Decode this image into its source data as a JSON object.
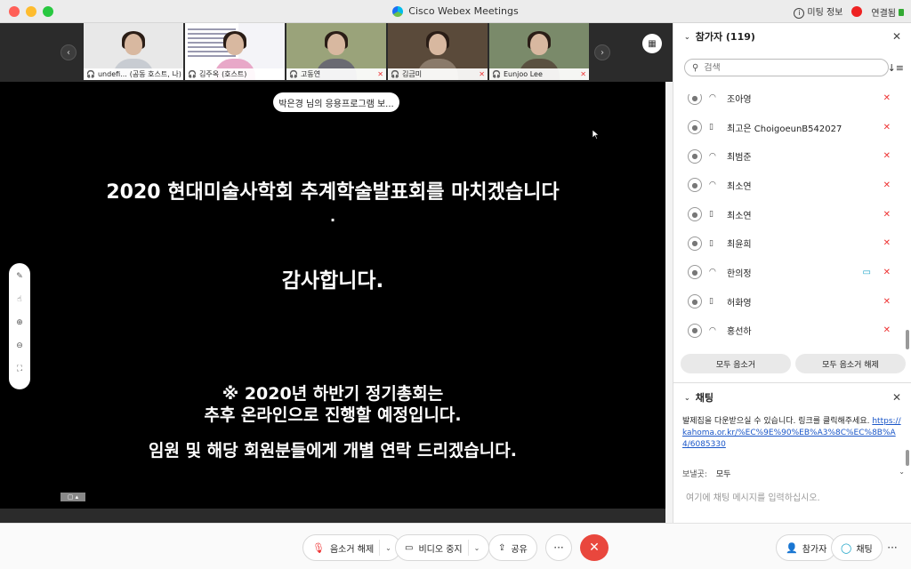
{
  "window": {
    "title": "Cisco Webex Meetings",
    "meeting_info": "미팅 정보",
    "status": "연결됨"
  },
  "thumbnails": [
    {
      "name": "undefi...",
      "sub": "(공동 호스트, 나)",
      "muted": true,
      "bg": "#e8e8e8",
      "shirt": "#c8ccd2",
      "active": false
    },
    {
      "name": "김주옥",
      "sub": "(호스트)",
      "muted": false,
      "bg": "#f4f4f8",
      "shirt": "#e8a8c8",
      "active": true
    },
    {
      "name": "고동연",
      "sub": "",
      "muted": true,
      "bg": "#9aa37a",
      "shirt": "#6a6a72",
      "active": false
    },
    {
      "name": "김금미",
      "sub": "",
      "muted": true,
      "bg": "#5a4a3a",
      "shirt": "#8a7a6a",
      "active": false
    },
    {
      "name": "Eunjoo Lee",
      "sub": "",
      "muted": true,
      "bg": "#7a8a6a",
      "shirt": "#5a5040",
      "active": false
    }
  ],
  "share_tag": "박은경 님의 응용프로그램 보...",
  "slide": {
    "title": "2020 현대미술사학회 추계학술발표회를 마치겠습니다",
    "dot": "·",
    "thanks": "감사합니다.",
    "note1": "※ 2020년 하반기 정기총회는",
    "note2": "추후 온라인으로 진행할 예정입니다.",
    "note3": "임원 및 해당 회원분들에게 개별 연락 드리겠습니다.",
    "badge": "▢ ▴"
  },
  "toolbar": {
    "mute_label": "음소거 해제",
    "video_label": "비디오 중지",
    "share_label": "공유",
    "more": "···",
    "end": "✕",
    "participants_label": "참가자",
    "chat_label": "채팅",
    "more_right": "···"
  },
  "participants_panel": {
    "title": "참가자 (119)",
    "search_placeholder": "검색",
    "rows": [
      {
        "name": "조아영",
        "device": "headset",
        "video": false
      },
      {
        "name": "최고은 ChoigoeunB542027",
        "device": "phone",
        "video": false
      },
      {
        "name": "최범준",
        "device": "headset",
        "video": false
      },
      {
        "name": "최소연",
        "device": "headset",
        "video": false
      },
      {
        "name": "최소연",
        "device": "phone",
        "video": false
      },
      {
        "name": "최윤희",
        "device": "phone",
        "video": false
      },
      {
        "name": "한의정",
        "device": "headset",
        "video": true
      },
      {
        "name": "허화영",
        "device": "phone",
        "video": false
      },
      {
        "name": "홍선하",
        "device": "headset",
        "video": false
      }
    ],
    "mute_all": "모두 음소거",
    "unmute_all": "모두 음소거 해제"
  },
  "chat_panel": {
    "title": "채팅",
    "message": "발제집을 다운받으실 수 있습니다. 링크를 클릭해주세요.",
    "link": "https://kahoma.or.kr/%EC%9E%90%EB%A3%8C%EC%8B%A4/6085330",
    "send_to_label": "보낼곳:",
    "send_to_value": "모두",
    "input_placeholder": "여기에 채팅 메시지를 입력하십시오."
  },
  "colors": {
    "accent": "#19a2c6",
    "end_call": "#e9473d",
    "muted": "#e33333"
  }
}
